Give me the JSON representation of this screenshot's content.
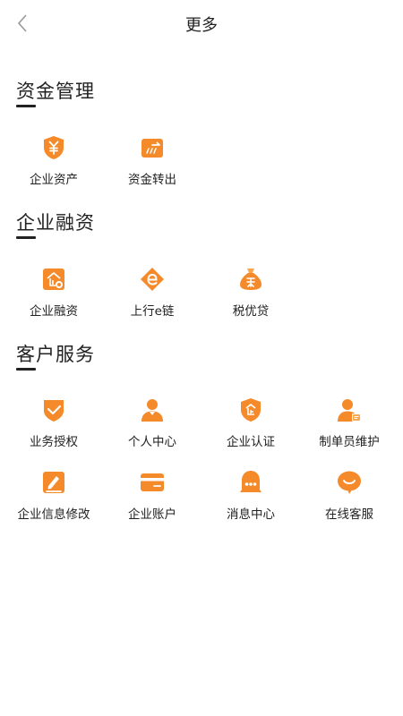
{
  "header": {
    "title": "更多"
  },
  "sections": [
    {
      "title": "资金管理",
      "items": [
        {
          "label": "企业资产",
          "icon": "yuan-shield-icon"
        },
        {
          "label": "资金转出",
          "icon": "transfer-card-icon"
        }
      ]
    },
    {
      "title": "企业融资",
      "items": [
        {
          "label": "企业融资",
          "icon": "enterprise-finance-icon"
        },
        {
          "label": "上行e链",
          "icon": "e-chain-icon"
        },
        {
          "label": "税优贷",
          "icon": "loan-bag-icon"
        }
      ]
    },
    {
      "title": "客户服务",
      "items": [
        {
          "label": "业务授权",
          "icon": "authorization-icon"
        },
        {
          "label": "个人中心",
          "icon": "person-icon"
        },
        {
          "label": "企业认证",
          "icon": "enterprise-shield-icon"
        },
        {
          "label": "制单员维护",
          "icon": "operator-icon"
        },
        {
          "label": "企业信息修改",
          "icon": "edit-icon"
        },
        {
          "label": "企业账户",
          "icon": "card-icon"
        },
        {
          "label": "消息中心",
          "icon": "message-icon"
        },
        {
          "label": "在线客服",
          "icon": "chat-icon"
        }
      ]
    }
  ],
  "colors": {
    "accent": "#F58A2B",
    "accent_light": "#F9A84F",
    "text": "#222222"
  }
}
